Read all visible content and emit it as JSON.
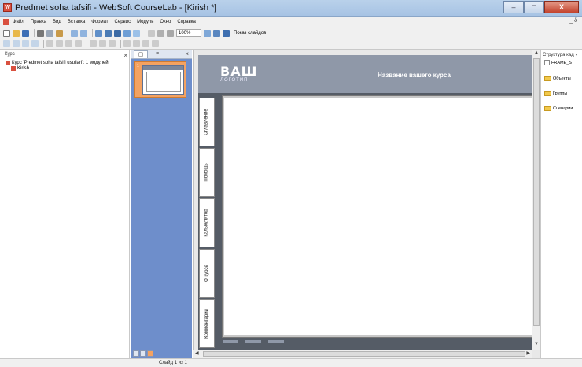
{
  "window": {
    "title": "Predmet soha tafsifi - WebSoft CourseLab - [Kirish *]",
    "controls": [
      "–",
      "□",
      "X"
    ]
  },
  "menu": {
    "items": [
      "Файл",
      "Правка",
      "Вид",
      "Вставка",
      "Формат",
      "Сервис",
      "Модуль",
      "Окно",
      "Справка"
    ],
    "mdi_controls": "_ ð"
  },
  "toolbar": {
    "zoom": "100%",
    "slideshow_label": "Показ слайдов"
  },
  "course_tree": {
    "title": "Курс",
    "close": "×",
    "items": [
      {
        "label": "Курс 'Predmet soha tafsifi usullari': 1 модулей",
        "level": 0
      },
      {
        "label": "Kirish",
        "level": 1
      }
    ]
  },
  "slides_panel": {
    "close": "×",
    "slide_number": "1"
  },
  "slide": {
    "logo_big": "ВАШ",
    "logo_small": "ЛОГОТИП",
    "course_title": "Название вашего курса",
    "side_tabs": [
      "Оглавление",
      "Помощь",
      "Калькулятор",
      "О курсе",
      "Комментарий"
    ]
  },
  "structure_panel": {
    "title": "Структура кад ▾",
    "items": [
      {
        "label": "FRAME_S",
        "type": "page"
      },
      {
        "label": "Объекты",
        "type": "folder"
      },
      {
        "label": "Группы",
        "type": "folder"
      },
      {
        "label": "Сценарии",
        "type": "folder"
      }
    ]
  },
  "status": {
    "slide_counter": "Слайд 1 из 1"
  },
  "colors": {
    "accent": "#6e8ecb",
    "selection": "#f4a261",
    "slide_header": "#8f98a8"
  }
}
